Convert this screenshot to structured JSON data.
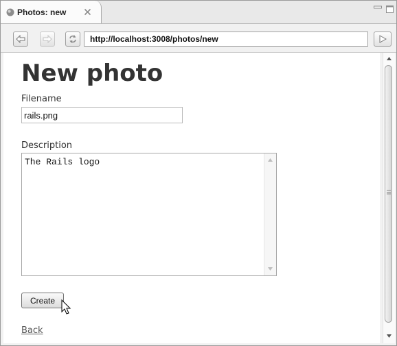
{
  "tab": {
    "title": "Photos: new"
  },
  "toolbar": {
    "url": "http://localhost:3008/photos/new"
  },
  "page": {
    "heading": "New photo",
    "filename_label": "Filename",
    "filename_value": "rails.png",
    "description_label": "Description",
    "description_value": "The Rails logo",
    "create_label": "Create",
    "back_label": "Back"
  },
  "icons": {
    "tab": [
      "globe-icon",
      "close-icon"
    ],
    "window": [
      "minimize-icon",
      "maximize-icon"
    ],
    "toolbar": [
      "back-arrow-icon",
      "forward-arrow-icon",
      "refresh-icon",
      "go-icon"
    ],
    "page": [
      "cursor-icon",
      "scroll-grip-icon"
    ]
  },
  "colors": {
    "page_background": "#ffffff",
    "chrome": "#f1f1f1",
    "heading": "#333333",
    "link": "#555555"
  }
}
